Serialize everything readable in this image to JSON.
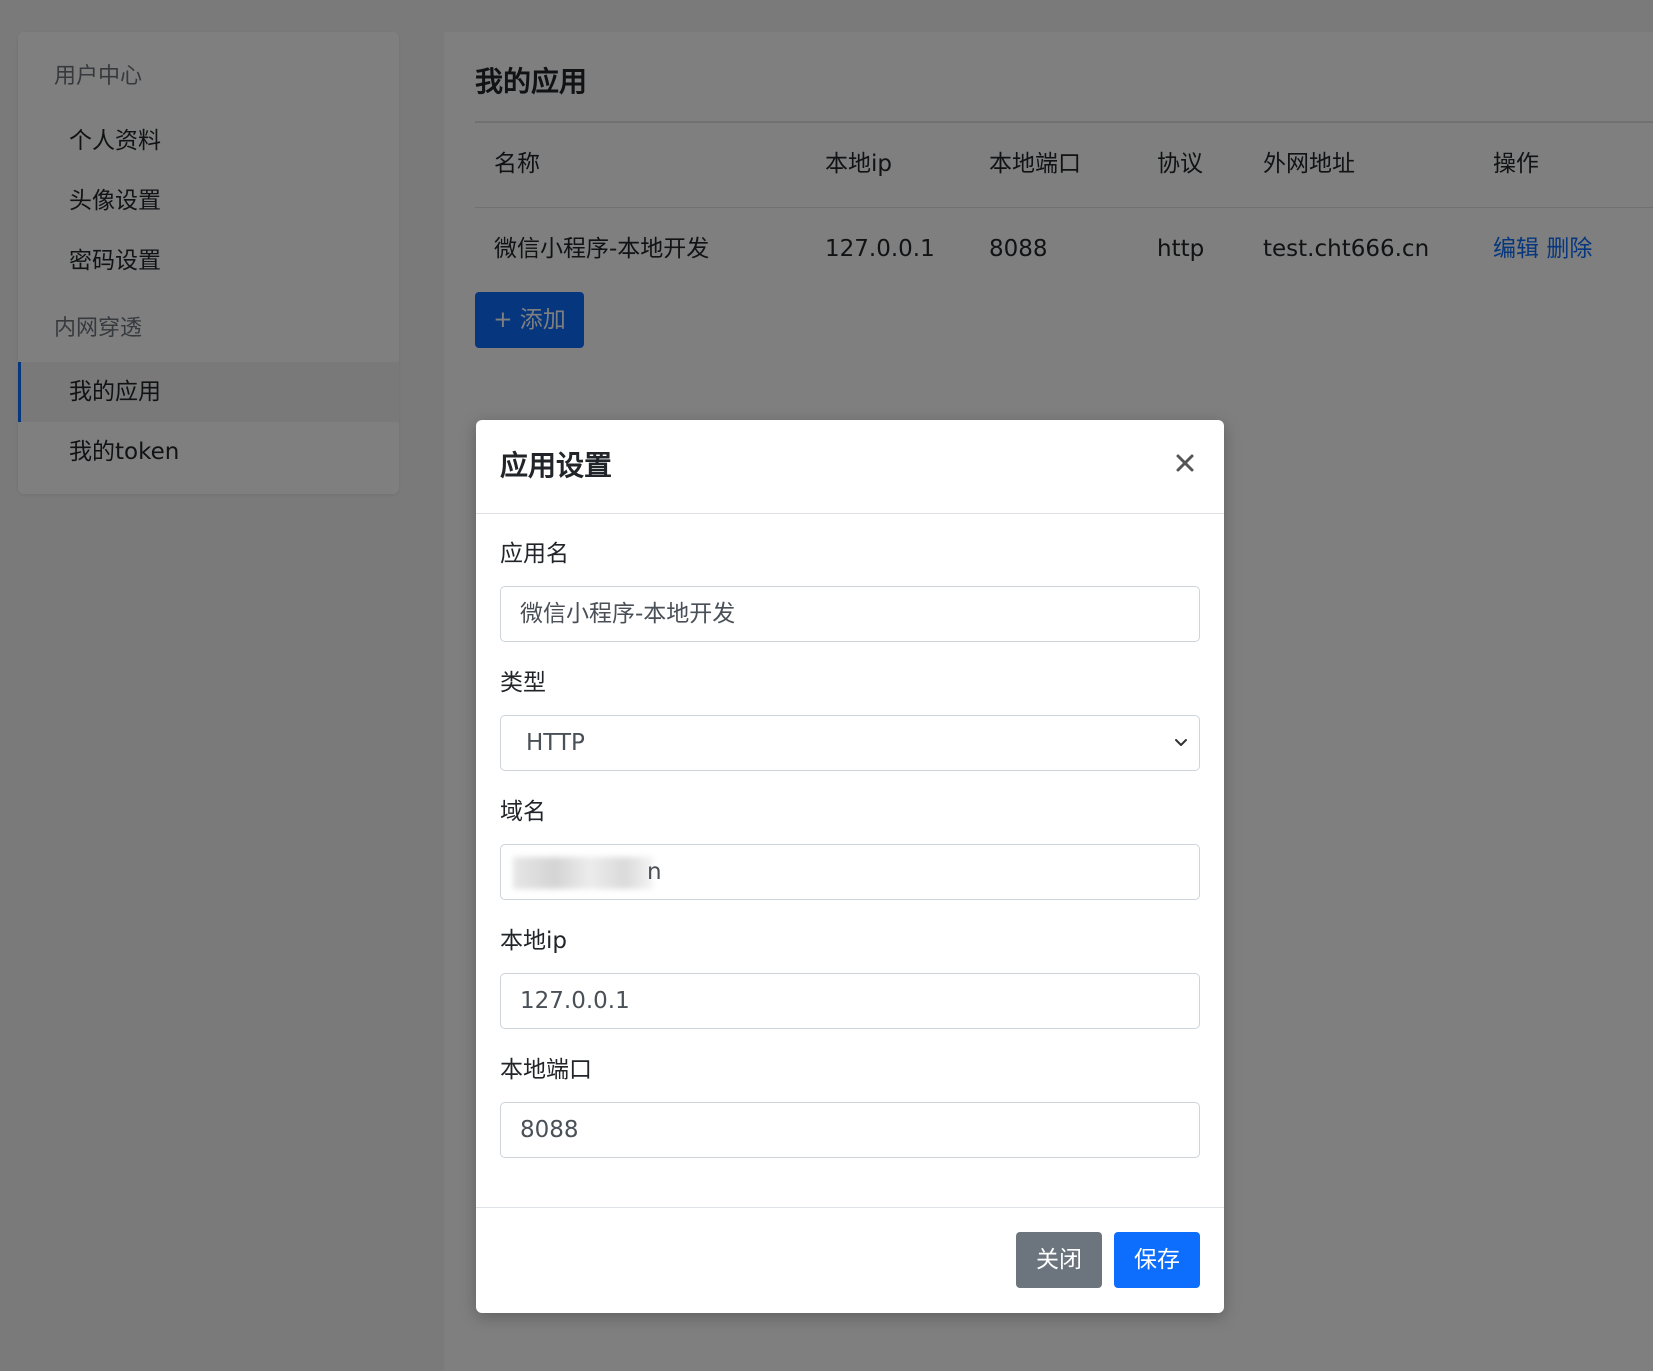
{
  "sidebar": {
    "groups": [
      {
        "title": "用户中心",
        "items": [
          {
            "label": "个人资料"
          },
          {
            "label": "头像设置"
          },
          {
            "label": "密码设置"
          }
        ]
      },
      {
        "title": "内网穿透",
        "items": [
          {
            "label": "我的应用"
          },
          {
            "label": "我的token"
          }
        ]
      }
    ],
    "active_item": "我的应用"
  },
  "main": {
    "title": "我的应用",
    "table": {
      "columns": [
        "名称",
        "本地ip",
        "本地端口",
        "协议",
        "外网地址",
        "操作"
      ],
      "rows": [
        {
          "name": "微信小程序-本地开发",
          "local_ip": "127.0.0.1",
          "local_port": "8088",
          "protocol": "http",
          "external_address": "test.cht666.cn",
          "actions": {
            "edit": "编辑",
            "delete": "删除"
          }
        }
      ]
    },
    "add_button": "+ 添加"
  },
  "modal": {
    "title": "应用设置",
    "close_icon": "close-icon",
    "fields": {
      "app_name": {
        "label": "应用名",
        "value": "微信小程序-本地开发"
      },
      "type": {
        "label": "类型",
        "value": "HTTP"
      },
      "domain": {
        "label": "域名",
        "value_visible_suffix": "n"
      },
      "local_ip": {
        "label": "本地ip",
        "value": "127.0.0.1"
      },
      "local_port": {
        "label": "本地端口",
        "value": "8088"
      }
    },
    "buttons": {
      "close": "关闭",
      "save": "保存"
    }
  },
  "colors": {
    "primary": "#0d6efd",
    "secondary": "#6c757d",
    "link": "#0d6efd",
    "overlay": "rgba(0,0,0,0.5)"
  }
}
